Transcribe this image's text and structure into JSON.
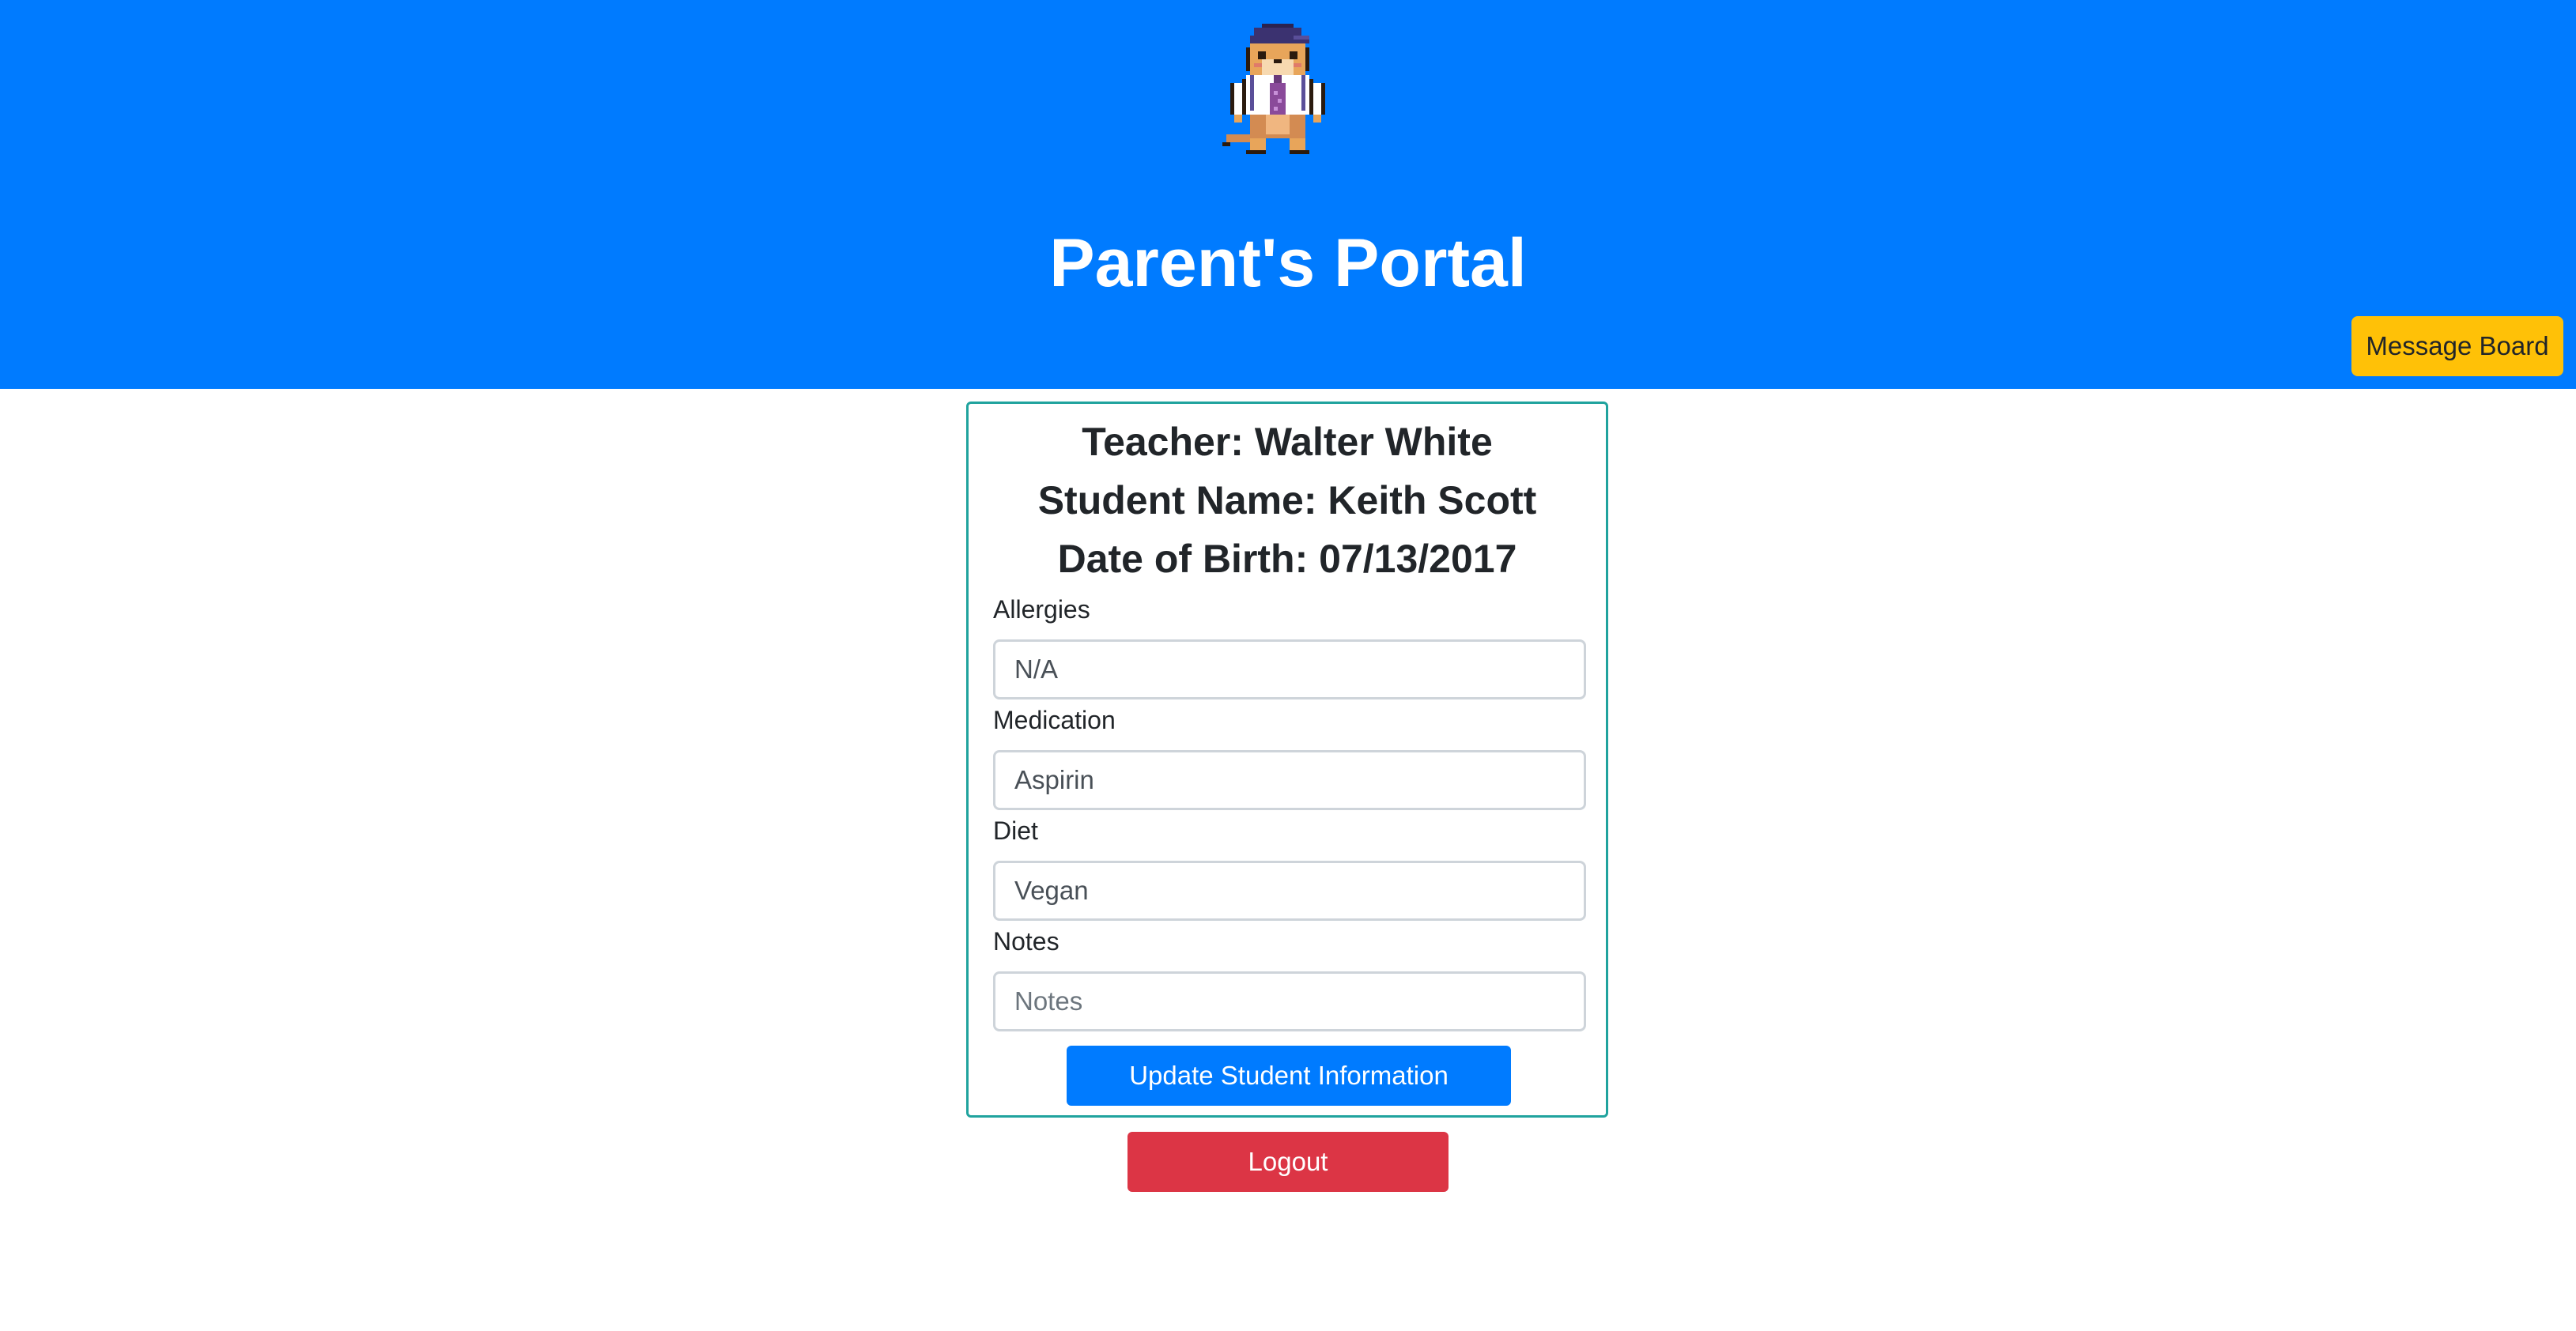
{
  "header": {
    "title": "Parent's Portal",
    "message_board_label": "Message Board",
    "background_color": "#007bff"
  },
  "mascot": {
    "icon": "hamster-student-mascot-icon"
  },
  "student_card": {
    "teacher": "Teacher: Walter White",
    "student_name": "Student Name: Keith Scott",
    "date_of_birth": "Date of Birth: 07/13/2017",
    "fields": {
      "allergies": {
        "label": "Allergies",
        "value": "N/A",
        "placeholder": ""
      },
      "medication": {
        "label": "Medication",
        "value": "Aspirin",
        "placeholder": ""
      },
      "diet": {
        "label": "Diet",
        "value": "Vegan",
        "placeholder": ""
      },
      "notes": {
        "label": "Notes",
        "value": "",
        "placeholder": "Notes"
      }
    },
    "update_label": "Update Student Information"
  },
  "logout_label": "Logout",
  "colors": {
    "primary": "#007bff",
    "warning": "#ffc107",
    "danger": "#dc3545",
    "card_border": "#20a39e"
  }
}
